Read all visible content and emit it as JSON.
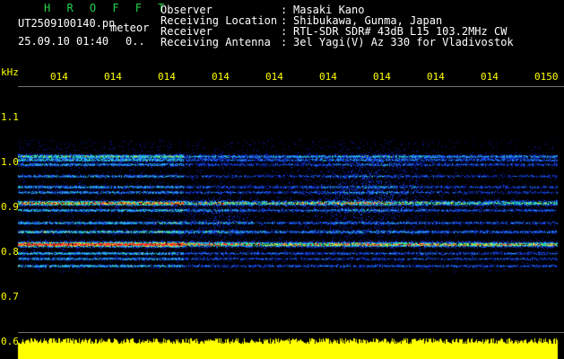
{
  "header": {
    "app_title": "H R O F F T",
    "filename": "UT2509100140.pn",
    "tag": "meteor",
    "datetime": "25.09.10 01:40",
    "counter": "0..",
    "fields": [
      {
        "label": "Observer",
        "sep": ":",
        "value": "Masaki Kano"
      },
      {
        "label": "Receiving Location",
        "sep": ":",
        "value": "Shibukawa, Gunma, Japan"
      },
      {
        "label": "Receiver",
        "sep": ":",
        "value": "RTL-SDR SDR# 43dB L15 103.2MHz CW"
      },
      {
        "label": "Receiving Antenna",
        "sep": ":",
        "value": "3el Yagi(V) Az 330 for Vladivostok"
      }
    ]
  },
  "time_axis": {
    "labels": [
      "014",
      "014",
      "014",
      "014",
      "014",
      "014",
      "014",
      "014",
      "014",
      "0150"
    ]
  },
  "freq_axis": {
    "unit": "kHz",
    "labels": [
      "1.1",
      "1.0",
      "0.9",
      "0.8",
      "0.7",
      "0.6"
    ]
  },
  "colors": {
    "background": "#000000",
    "axis_text": "#ffff00",
    "title": "#22d24a",
    "noise_floor": "#0a1a9c",
    "signal_strong": "#ff2828",
    "level_bar": "#ffff00"
  }
}
